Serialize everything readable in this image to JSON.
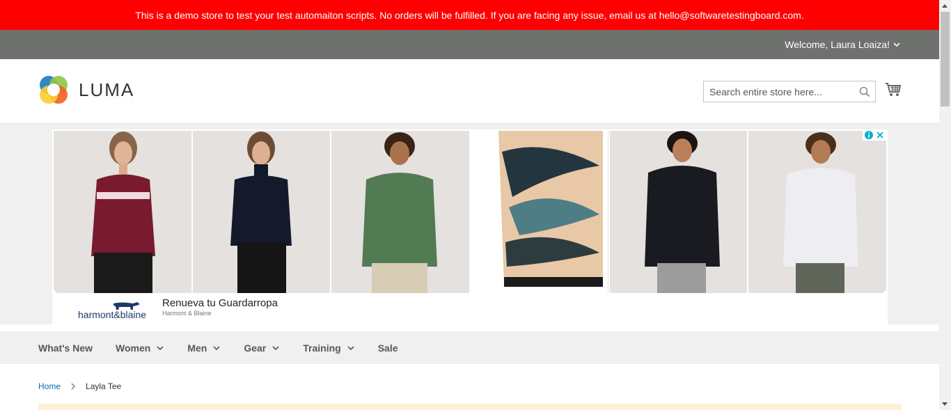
{
  "demo_notice": "This is a demo store to test your test automaiton scripts. No orders will be fulfilled. If you are facing any issue, email us at hello@softwaretestingboard.com.",
  "account": {
    "welcome": "Welcome, Laura Loaiza!"
  },
  "logo": {
    "text": "LUMA"
  },
  "search": {
    "placeholder": "Search entire store here..."
  },
  "ad": {
    "title": "Renueva tu Guardarropa",
    "advertiser": "Harmont & Blaine",
    "brand_logo_text": "harmont&blaine",
    "tiles": [
      "burgundy-sweater",
      "navy-turtleneck",
      "green-hoodie",
      "printed-scarf",
      "black-jacket",
      "striped-shirt"
    ]
  },
  "nav": {
    "items": [
      "What's New",
      "Women",
      "Men",
      "Gear",
      "Training",
      "Sale"
    ]
  },
  "breadcrumb": {
    "home": "Home",
    "current": "Layla Tee"
  },
  "colors": {
    "demo_bar": "#ff0000",
    "top_bar": "#6e716e",
    "link": "#006bb4",
    "nav_bg": "#f0f0f0"
  }
}
